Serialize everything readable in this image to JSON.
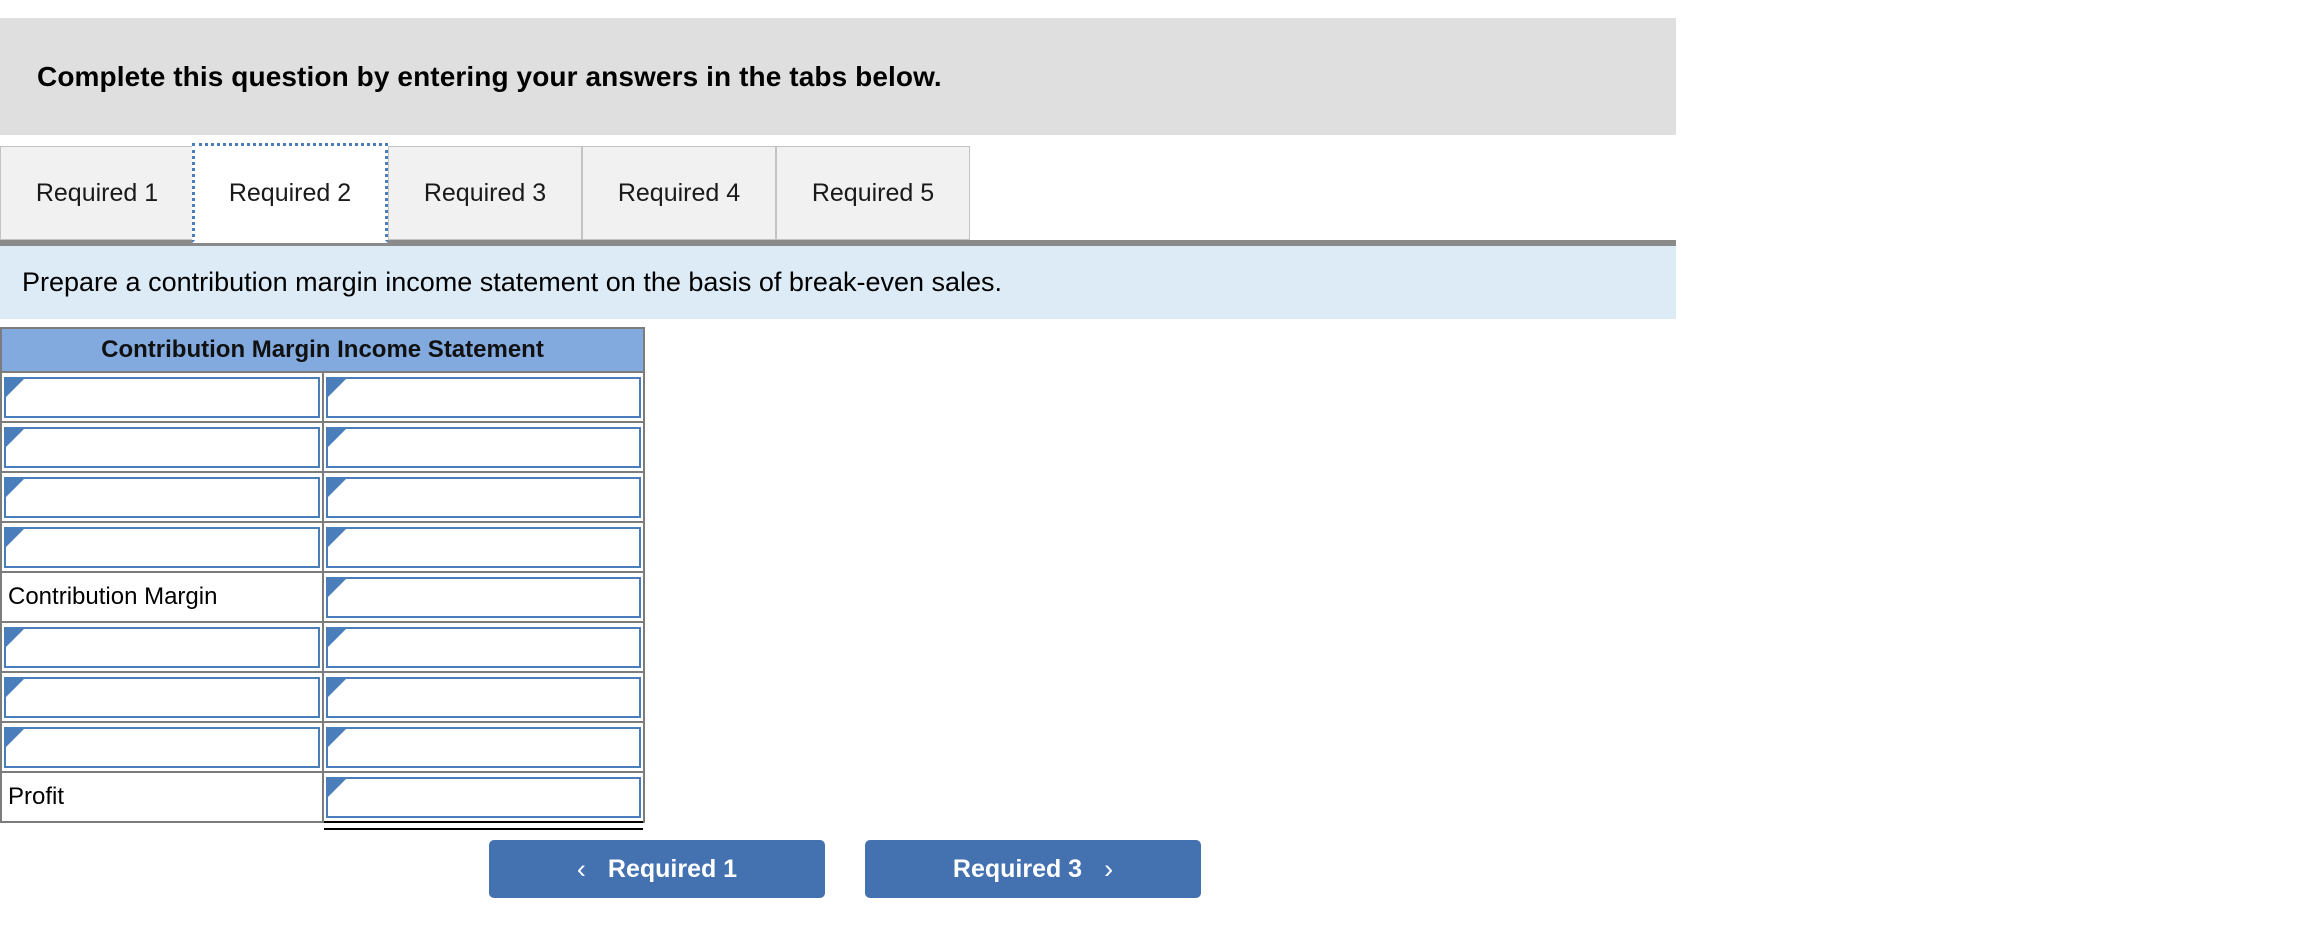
{
  "banner": {
    "text": "Complete this question by entering your answers in the tabs below."
  },
  "tabs": {
    "active_index": 1,
    "items": [
      {
        "label": "Required 1"
      },
      {
        "label": "Required 2"
      },
      {
        "label": "Required 3"
      },
      {
        "label": "Required 4"
      },
      {
        "label": "Required 5"
      }
    ]
  },
  "instruction": {
    "text": "Prepare a contribution margin income statement on the basis of break-even sales."
  },
  "statement": {
    "title": "Contribution Margin Income Statement",
    "rows": [
      {
        "label": "",
        "value": "",
        "label_type": "input",
        "value_type": "input",
        "rule": "none"
      },
      {
        "label": "",
        "value": "",
        "label_type": "input",
        "value_type": "input",
        "rule": "none"
      },
      {
        "label": "",
        "value": "",
        "label_type": "input",
        "value_type": "input",
        "rule": "none"
      },
      {
        "label": "",
        "value": "",
        "label_type": "input",
        "value_type": "input",
        "rule": "subtotal"
      },
      {
        "label": "Contribution Margin",
        "value": "",
        "label_type": "static",
        "value_type": "input",
        "rule": "none"
      },
      {
        "label": "",
        "value": "",
        "label_type": "input",
        "value_type": "input",
        "rule": "none"
      },
      {
        "label": "",
        "value": "",
        "label_type": "input",
        "value_type": "input",
        "rule": "none"
      },
      {
        "label": "",
        "value": "",
        "label_type": "input",
        "value_type": "input",
        "rule": "subtotal"
      },
      {
        "label": "Profit",
        "value": "",
        "label_type": "static",
        "value_type": "input",
        "rule": "total"
      }
    ]
  },
  "navigation": {
    "prev_label": "Required 1",
    "next_label": "Required 3",
    "prev_icon": "chevron-left-icon",
    "next_icon": "chevron-right-icon",
    "prev_chevron": "‹",
    "next_chevron": "›"
  },
  "colors": {
    "banner_bg": "#dfdfdf",
    "instruction_bg": "#ddebf7",
    "table_header_bg": "#82aadf",
    "input_border": "#4a7ebb",
    "button_bg": "#4472b0",
    "tab_inactive_bg": "#f1f1f1"
  }
}
